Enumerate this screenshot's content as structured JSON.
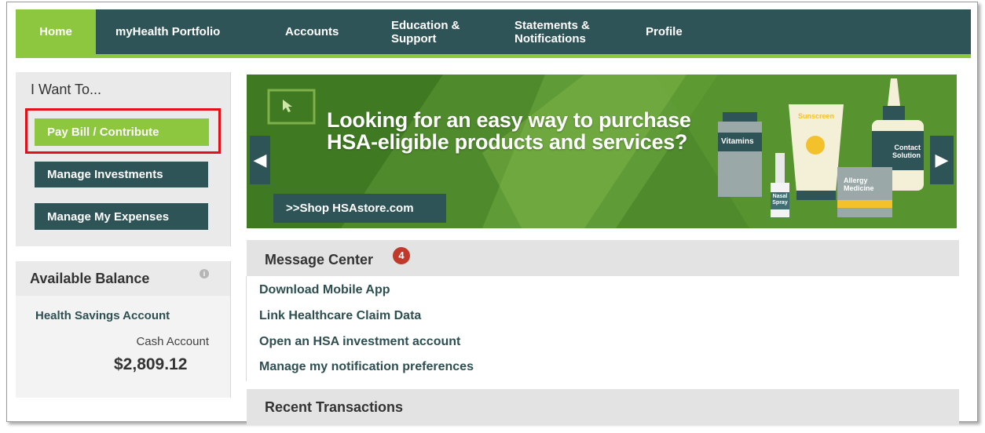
{
  "nav": {
    "items": [
      {
        "label": "Home"
      },
      {
        "label": "myHealth Portfolio"
      },
      {
        "label": "Accounts"
      },
      {
        "label": "Education & Support"
      },
      {
        "label": "Statements & Notifications"
      },
      {
        "label": "Profile"
      }
    ]
  },
  "want": {
    "title": "I Want To...",
    "buttons": [
      {
        "label": "Pay Bill / Contribute"
      },
      {
        "label": "Manage Investments"
      },
      {
        "label": "Manage My Expenses"
      }
    ]
  },
  "balance": {
    "title": "Available Balance",
    "account_label": "Health Savings Account",
    "cash_label": "Cash Account",
    "amount": "$2,809.12"
  },
  "banner": {
    "headline_line1": "Looking for an easy way to purchase",
    "headline_line2": "HSA-eligible products and services?",
    "cta": ">>Shop HSAstore.com",
    "products": {
      "vitamins": "Vitamins",
      "sunscreen": "Sunscreen",
      "contact_line1": "Contact",
      "contact_line2": "Solution",
      "allergy_line1": "Allergy",
      "allergy_line2": "Medicine",
      "nasal_line1": "Nasal",
      "nasal_line2": "Spray"
    }
  },
  "message_center": {
    "title": "Message Center",
    "badge": "4",
    "links": [
      {
        "label": "Download Mobile App"
      },
      {
        "label": "Link Healthcare Claim Data"
      },
      {
        "label": "Open an HSA investment account"
      },
      {
        "label": "Manage my notification preferences"
      }
    ]
  },
  "recent": {
    "title": "Recent Transactions"
  },
  "colors": {
    "nav_bg": "#2e5457",
    "accent_green": "#8dc63f",
    "highlight_red": "#e3101a",
    "badge_red": "#c0392b"
  }
}
